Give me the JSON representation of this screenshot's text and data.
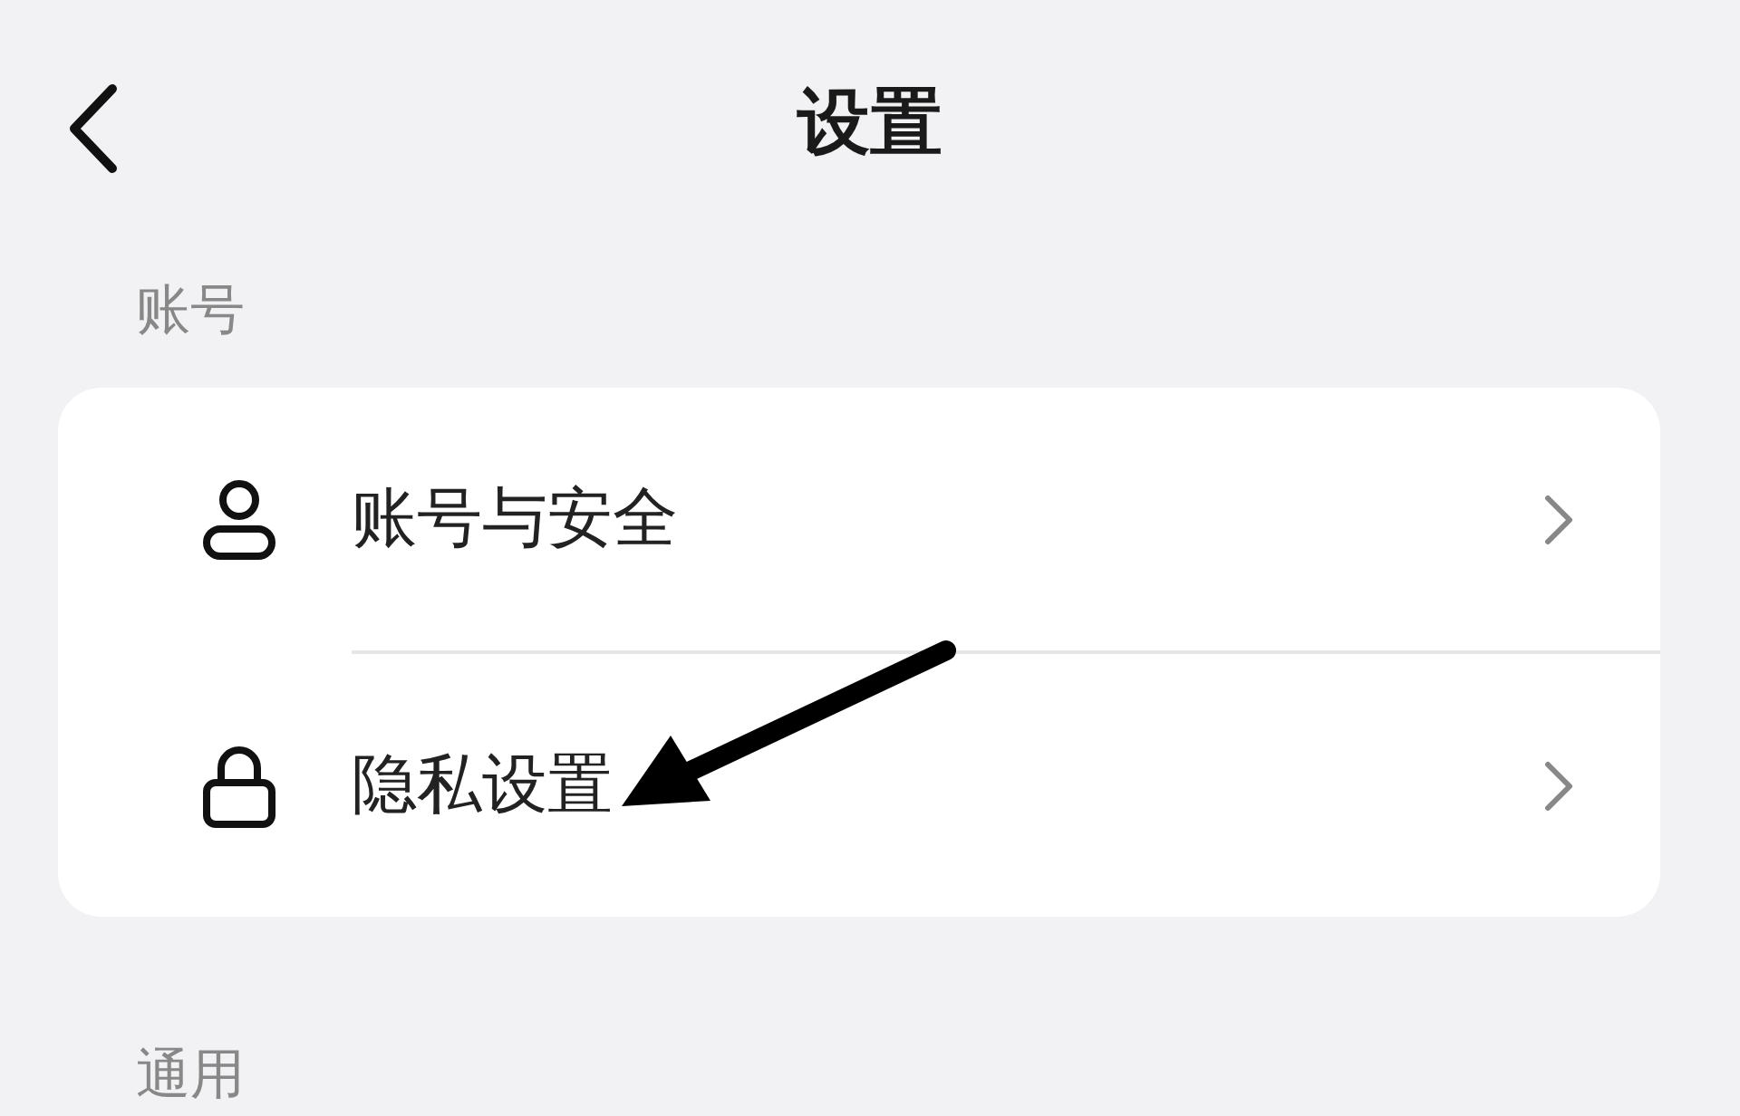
{
  "header": {
    "title": "设置"
  },
  "sections": [
    {
      "title": "账号",
      "items": [
        {
          "label": "账号与安全"
        },
        {
          "label": "隐私设置"
        }
      ]
    },
    {
      "title": "通用"
    }
  ]
}
